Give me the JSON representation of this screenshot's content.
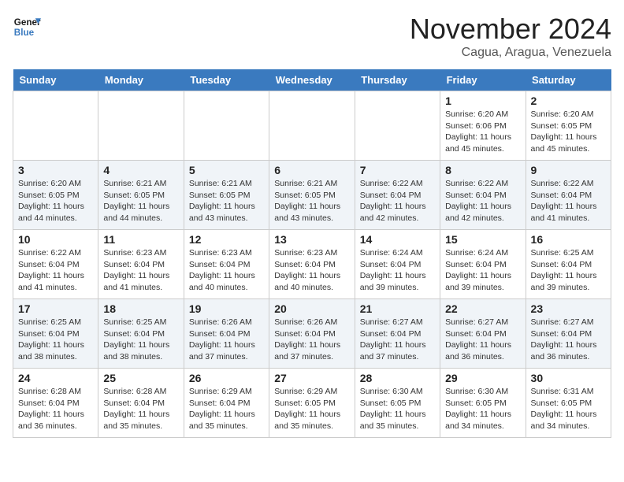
{
  "header": {
    "logo_line1": "General",
    "logo_line2": "Blue",
    "month": "November 2024",
    "location": "Cagua, Aragua, Venezuela"
  },
  "weekdays": [
    "Sunday",
    "Monday",
    "Tuesday",
    "Wednesday",
    "Thursday",
    "Friday",
    "Saturday"
  ],
  "weeks": [
    [
      {
        "day": "",
        "sunrise": "",
        "sunset": "",
        "daylight": ""
      },
      {
        "day": "",
        "sunrise": "",
        "sunset": "",
        "daylight": ""
      },
      {
        "day": "",
        "sunrise": "",
        "sunset": "",
        "daylight": ""
      },
      {
        "day": "",
        "sunrise": "",
        "sunset": "",
        "daylight": ""
      },
      {
        "day": "",
        "sunrise": "",
        "sunset": "",
        "daylight": ""
      },
      {
        "day": "1",
        "sunrise": "Sunrise: 6:20 AM",
        "sunset": "Sunset: 6:06 PM",
        "daylight": "Daylight: 11 hours and 45 minutes."
      },
      {
        "day": "2",
        "sunrise": "Sunrise: 6:20 AM",
        "sunset": "Sunset: 6:05 PM",
        "daylight": "Daylight: 11 hours and 45 minutes."
      }
    ],
    [
      {
        "day": "3",
        "sunrise": "Sunrise: 6:20 AM",
        "sunset": "Sunset: 6:05 PM",
        "daylight": "Daylight: 11 hours and 44 minutes."
      },
      {
        "day": "4",
        "sunrise": "Sunrise: 6:21 AM",
        "sunset": "Sunset: 6:05 PM",
        "daylight": "Daylight: 11 hours and 44 minutes."
      },
      {
        "day": "5",
        "sunrise": "Sunrise: 6:21 AM",
        "sunset": "Sunset: 6:05 PM",
        "daylight": "Daylight: 11 hours and 43 minutes."
      },
      {
        "day": "6",
        "sunrise": "Sunrise: 6:21 AM",
        "sunset": "Sunset: 6:05 PM",
        "daylight": "Daylight: 11 hours and 43 minutes."
      },
      {
        "day": "7",
        "sunrise": "Sunrise: 6:22 AM",
        "sunset": "Sunset: 6:04 PM",
        "daylight": "Daylight: 11 hours and 42 minutes."
      },
      {
        "day": "8",
        "sunrise": "Sunrise: 6:22 AM",
        "sunset": "Sunset: 6:04 PM",
        "daylight": "Daylight: 11 hours and 42 minutes."
      },
      {
        "day": "9",
        "sunrise": "Sunrise: 6:22 AM",
        "sunset": "Sunset: 6:04 PM",
        "daylight": "Daylight: 11 hours and 41 minutes."
      }
    ],
    [
      {
        "day": "10",
        "sunrise": "Sunrise: 6:22 AM",
        "sunset": "Sunset: 6:04 PM",
        "daylight": "Daylight: 11 hours and 41 minutes."
      },
      {
        "day": "11",
        "sunrise": "Sunrise: 6:23 AM",
        "sunset": "Sunset: 6:04 PM",
        "daylight": "Daylight: 11 hours and 41 minutes."
      },
      {
        "day": "12",
        "sunrise": "Sunrise: 6:23 AM",
        "sunset": "Sunset: 6:04 PM",
        "daylight": "Daylight: 11 hours and 40 minutes."
      },
      {
        "day": "13",
        "sunrise": "Sunrise: 6:23 AM",
        "sunset": "Sunset: 6:04 PM",
        "daylight": "Daylight: 11 hours and 40 minutes."
      },
      {
        "day": "14",
        "sunrise": "Sunrise: 6:24 AM",
        "sunset": "Sunset: 6:04 PM",
        "daylight": "Daylight: 11 hours and 39 minutes."
      },
      {
        "day": "15",
        "sunrise": "Sunrise: 6:24 AM",
        "sunset": "Sunset: 6:04 PM",
        "daylight": "Daylight: 11 hours and 39 minutes."
      },
      {
        "day": "16",
        "sunrise": "Sunrise: 6:25 AM",
        "sunset": "Sunset: 6:04 PM",
        "daylight": "Daylight: 11 hours and 39 minutes."
      }
    ],
    [
      {
        "day": "17",
        "sunrise": "Sunrise: 6:25 AM",
        "sunset": "Sunset: 6:04 PM",
        "daylight": "Daylight: 11 hours and 38 minutes."
      },
      {
        "day": "18",
        "sunrise": "Sunrise: 6:25 AM",
        "sunset": "Sunset: 6:04 PM",
        "daylight": "Daylight: 11 hours and 38 minutes."
      },
      {
        "day": "19",
        "sunrise": "Sunrise: 6:26 AM",
        "sunset": "Sunset: 6:04 PM",
        "daylight": "Daylight: 11 hours and 37 minutes."
      },
      {
        "day": "20",
        "sunrise": "Sunrise: 6:26 AM",
        "sunset": "Sunset: 6:04 PM",
        "daylight": "Daylight: 11 hours and 37 minutes."
      },
      {
        "day": "21",
        "sunrise": "Sunrise: 6:27 AM",
        "sunset": "Sunset: 6:04 PM",
        "daylight": "Daylight: 11 hours and 37 minutes."
      },
      {
        "day": "22",
        "sunrise": "Sunrise: 6:27 AM",
        "sunset": "Sunset: 6:04 PM",
        "daylight": "Daylight: 11 hours and 36 minutes."
      },
      {
        "day": "23",
        "sunrise": "Sunrise: 6:27 AM",
        "sunset": "Sunset: 6:04 PM",
        "daylight": "Daylight: 11 hours and 36 minutes."
      }
    ],
    [
      {
        "day": "24",
        "sunrise": "Sunrise: 6:28 AM",
        "sunset": "Sunset: 6:04 PM",
        "daylight": "Daylight: 11 hours and 36 minutes."
      },
      {
        "day": "25",
        "sunrise": "Sunrise: 6:28 AM",
        "sunset": "Sunset: 6:04 PM",
        "daylight": "Daylight: 11 hours and 35 minutes."
      },
      {
        "day": "26",
        "sunrise": "Sunrise: 6:29 AM",
        "sunset": "Sunset: 6:04 PM",
        "daylight": "Daylight: 11 hours and 35 minutes."
      },
      {
        "day": "27",
        "sunrise": "Sunrise: 6:29 AM",
        "sunset": "Sunset: 6:05 PM",
        "daylight": "Daylight: 11 hours and 35 minutes."
      },
      {
        "day": "28",
        "sunrise": "Sunrise: 6:30 AM",
        "sunset": "Sunset: 6:05 PM",
        "daylight": "Daylight: 11 hours and 35 minutes."
      },
      {
        "day": "29",
        "sunrise": "Sunrise: 6:30 AM",
        "sunset": "Sunset: 6:05 PM",
        "daylight": "Daylight: 11 hours and 34 minutes."
      },
      {
        "day": "30",
        "sunrise": "Sunrise: 6:31 AM",
        "sunset": "Sunset: 6:05 PM",
        "daylight": "Daylight: 11 hours and 34 minutes."
      }
    ]
  ]
}
